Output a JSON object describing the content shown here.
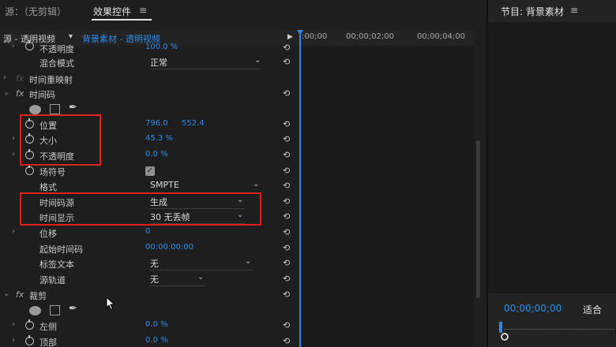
{
  "tabs": {
    "source": "源：（无剪辑）",
    "effect_controls": "效果控件",
    "program": "节目: 背景素材"
  },
  "menu_glyph": "≡",
  "subbar": {
    "source_label": "源 - 透明视频",
    "clip_label": "背景素材 - 透明视频",
    "caret": "▾",
    "play_glyph": "▶"
  },
  "timeline": {
    "ticks": [
      ":00;00",
      "00;00;02;00",
      "00;00;04;00"
    ]
  },
  "rows": {
    "opacity_top": {
      "label": "不透明度",
      "value": "100.0 %"
    },
    "blend_mode": {
      "label": "混合模式",
      "value": "正常"
    },
    "time_remap": {
      "label": "时间重映射"
    },
    "timecode": {
      "label": "时间码"
    },
    "position": {
      "label": "位置",
      "value_x": "796.0",
      "value_y": "552.4"
    },
    "scale": {
      "label": "大小",
      "value": "45.3 %"
    },
    "opacity": {
      "label": "不透明度",
      "value": "0.0 %"
    },
    "field_symbol": {
      "label": "场符号",
      "checked": "✓"
    },
    "format": {
      "label": "格式",
      "value": "SMPTE"
    },
    "timecode_source": {
      "label": "时间码源",
      "value": "生成"
    },
    "time_display": {
      "label": "时间显示",
      "value": "30 无丢帧"
    },
    "offset": {
      "label": "位移",
      "value": "0"
    },
    "start_timecode": {
      "label": "起始时间码",
      "value": "00:00:00:00"
    },
    "label_text": {
      "label": "标签文本",
      "value": "无"
    },
    "source_track": {
      "label": "源轨道",
      "value": "无"
    },
    "crop": {
      "label": "裁剪"
    },
    "left": {
      "label": "左侧",
      "value": "0.0 %"
    },
    "top": {
      "label": "顶部",
      "value": "0.0 %"
    }
  },
  "fx_glyph": "fx",
  "reset_glyph": "⟲",
  "chevron": "⌄",
  "twirl": "›",
  "twirl_open": "⌄",
  "program": {
    "timecode": "00;00;00;00",
    "fit": "适合"
  },
  "colors": {
    "accent": "#2d8ceb",
    "highlight_box": "#e0201d"
  }
}
